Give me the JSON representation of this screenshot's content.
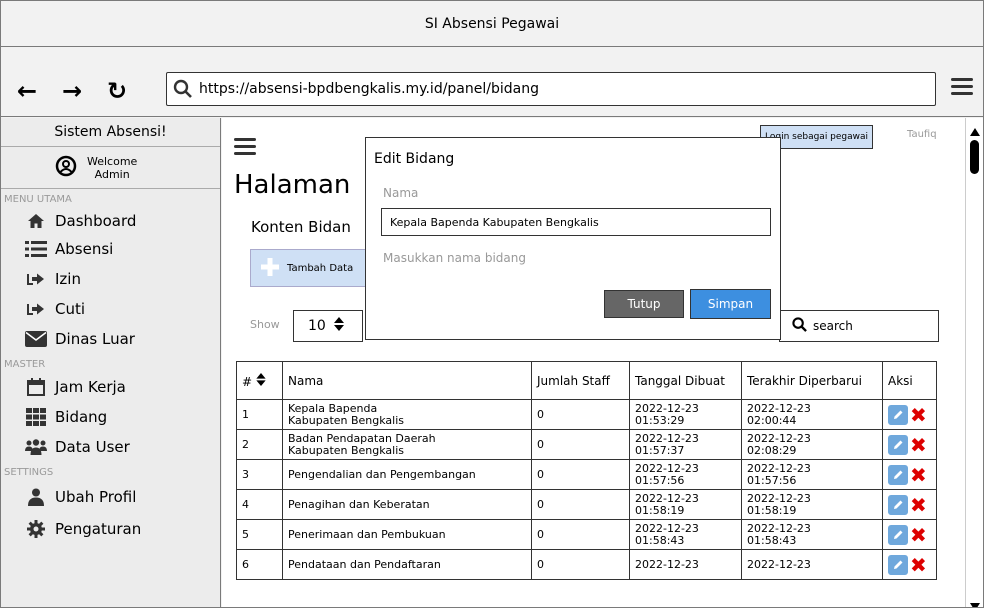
{
  "window": {
    "title": "SI Absensi Pegawai"
  },
  "browser": {
    "url": "https://absensi-bpdbengkalis.my.id/panel/bidang"
  },
  "sidebar": {
    "title": "Sistem Absensi!",
    "welcome_line1": "Welcome",
    "welcome_line2": "Admin",
    "section_menu": "MENU UTAMA",
    "section_master": "MASTER",
    "section_settings": "SETTINGS",
    "items": [
      {
        "label": "Dashboard",
        "icon": "home-icon"
      },
      {
        "label": "Absensi",
        "icon": "list-icon"
      },
      {
        "label": "Izin",
        "icon": "sign-in-icon"
      },
      {
        "label": "Cuti",
        "icon": "sign-in-icon"
      },
      {
        "label": "Dinas Luar",
        "icon": "envelope-icon"
      },
      {
        "label": "Jam Kerja",
        "icon": "calendar-icon"
      },
      {
        "label": "Bidang",
        "icon": "grid-icon"
      },
      {
        "label": "Data User",
        "icon": "users-icon"
      },
      {
        "label": "Ubah Profil",
        "icon": "user-icon"
      },
      {
        "label": "Pengaturan",
        "icon": "gear-icon"
      }
    ]
  },
  "header": {
    "login_badge": "Login sebagai pegawai",
    "user_name": "Taufiq"
  },
  "main": {
    "title": "Halaman",
    "subtitle": "Konten Bidan",
    "add_button": "Tambah Data",
    "show_label": "Show",
    "show_value": "10",
    "search_placeholder": "search"
  },
  "table": {
    "headers": [
      "#",
      "Nama",
      "Jumlah Staff",
      "Tanggal Dibuat",
      "Terakhir Diperbarui",
      "Aksi"
    ],
    "rows": [
      {
        "no": "1",
        "nama_1": "Kepala Bapenda",
        "nama_2": "Kabupaten Bengkalis",
        "staff": "0",
        "dibuat_1": "2022-12-23",
        "dibuat_2": "01:53:29",
        "diperbarui_1": "2022-12-23",
        "diperbarui_2": "02:00:44"
      },
      {
        "no": "2",
        "nama_1": "Badan Pendapatan Daerah",
        "nama_2": "Kabupaten Bengkalis",
        "staff": "0",
        "dibuat_1": "2022-12-23",
        "dibuat_2": "01:57:37",
        "diperbarui_1": "2022-12-23",
        "diperbarui_2": "02:08:29"
      },
      {
        "no": "3",
        "nama_1": "Pengendalian dan Pengembangan",
        "nama_2": "",
        "staff": "0",
        "dibuat_1": "2022-12-23",
        "dibuat_2": "01:57:56",
        "diperbarui_1": "2022-12-23",
        "diperbarui_2": "01:57:56"
      },
      {
        "no": "4",
        "nama_1": "Penagihan dan Keberatan",
        "nama_2": "",
        "staff": "0",
        "dibuat_1": "2022-12-23",
        "dibuat_2": "01:58:19",
        "diperbarui_1": "2022-12-23",
        "diperbarui_2": "01:58:19"
      },
      {
        "no": "5",
        "nama_1": "Penerimaan dan Pembukuan",
        "nama_2": "",
        "staff": "0",
        "dibuat_1": "2022-12-23",
        "dibuat_2": "01:58:43",
        "diperbarui_1": "2022-12-23",
        "diperbarui_2": "01:58:43"
      },
      {
        "no": "6",
        "nama_1": "Pendataan dan Pendaftaran",
        "nama_2": "",
        "staff": "0",
        "dibuat_1": "2022-12-23",
        "dibuat_2": "",
        "diperbarui_1": "2022-12-23",
        "diperbarui_2": ""
      }
    ]
  },
  "modal": {
    "title": "Edit Bidang",
    "label": "Nama",
    "value": "Kepala Bapenda Kabupaten Bengkalis",
    "help": "Masukkan nama bidang",
    "tutup": "Tutup",
    "simpan": "Simpan"
  },
  "colors": {
    "accent_blue": "#3d8fe0",
    "light_blue": "#cfe0f5",
    "delete_red": "#dd0000",
    "button_grey": "#666666"
  }
}
